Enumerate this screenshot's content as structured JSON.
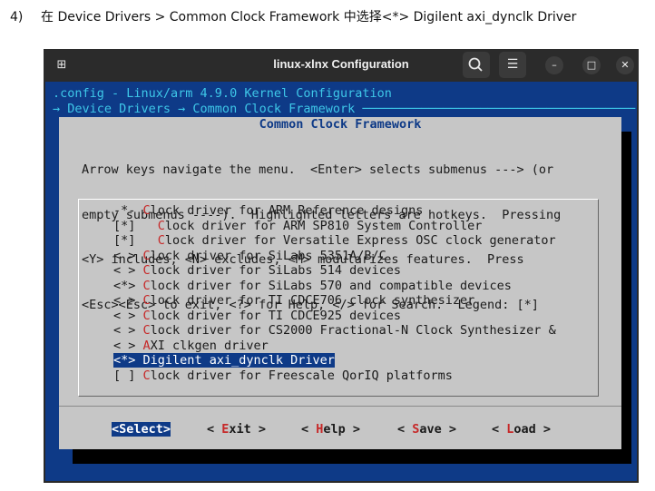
{
  "doc": {
    "step_number": "4)",
    "instruction": "在 Device Drivers > Common Clock Framework 中选择<*> Digilent axi_dynclk Driver"
  },
  "window": {
    "title": "linux-xlnx Configuration",
    "new_tab_icon": "⊞",
    "search_icon": "🔍",
    "menu_icon": "☰",
    "minimize_icon": "–",
    "maximize_icon": "□",
    "close_icon": "✕"
  },
  "terminal": {
    "header_line": ".config - Linux/arm 4.9.0 Kernel Configuration",
    "breadcrumb": "→ Device Drivers → Common Clock Framework ─────────────────────────────────────"
  },
  "dialog": {
    "title": "Common Clock Framework",
    "help_lines": [
      "Arrow keys navigate the menu.  <Enter> selects submenus ---> (or",
      "empty submenus ----).  Highlighted letters are hotkeys.  Pressing",
      "<Y> includes, <N> excludes, <M> modularizes features.  Press",
      "<Esc><Esc> to exit, <?> for Help, </> for Search.  Legend: [*]"
    ],
    "items": [
      {
        "mark": "-*-",
        "hot": "C",
        "rest": "lock driver for ARM Reference designs"
      },
      {
        "mark": "[*]",
        "hot": "C",
        "rest": "lock driver for ARM SP810 System Controller",
        "indent": true
      },
      {
        "mark": "[*]",
        "hot": "C",
        "rest": "lock driver for Versatile Express OSC clock generator",
        "indent": true
      },
      {
        "mark": "< >",
        "hot": "C",
        "rest": "lock driver for SiLabs 5351A/B/C"
      },
      {
        "mark": "< >",
        "hot": "C",
        "rest": "lock driver for SiLabs 514 devices"
      },
      {
        "mark": "<*>",
        "hot": "C",
        "rest": "lock driver for SiLabs 570 and compatible devices"
      },
      {
        "mark": "< >",
        "hot": "C",
        "rest": "lock driver for TI CDCE706 clock synthesizer"
      },
      {
        "mark": "< >",
        "hot": "C",
        "rest": "lock driver for TI CDCE925 devices"
      },
      {
        "mark": "< >",
        "hot": "C",
        "rest": "lock driver for CS2000 Fractional-N Clock Synthesizer &"
      },
      {
        "mark": "< >",
        "hot": "A",
        "rest": "XI clkgen driver"
      },
      {
        "mark": "<*>",
        "hot": "D",
        "rest": "igilent axi_dynclk Driver",
        "selected": true
      },
      {
        "mark": "[ ]",
        "hot": "C",
        "rest": "lock driver for Freescale QorIQ platforms"
      }
    ],
    "buttons": [
      {
        "pre": "<",
        "hot": "S",
        "rest": "elect>",
        "active": true
      },
      {
        "pre": "< ",
        "hot": "E",
        "rest": "xit >"
      },
      {
        "pre": "< ",
        "hot": "H",
        "rest": "elp >"
      },
      {
        "pre": "< ",
        "hot": "S",
        "rest": "ave >"
      },
      {
        "pre": "< ",
        "hot": "L",
        "rest": "oad >"
      }
    ]
  },
  "colors": {
    "terminal_bg": "#0e3a87",
    "terminal_fg": "#3ec7e8",
    "dialog_bg": "#c6c6c6",
    "hotkey": "#c62828",
    "highlight": "#0e3a87"
  }
}
